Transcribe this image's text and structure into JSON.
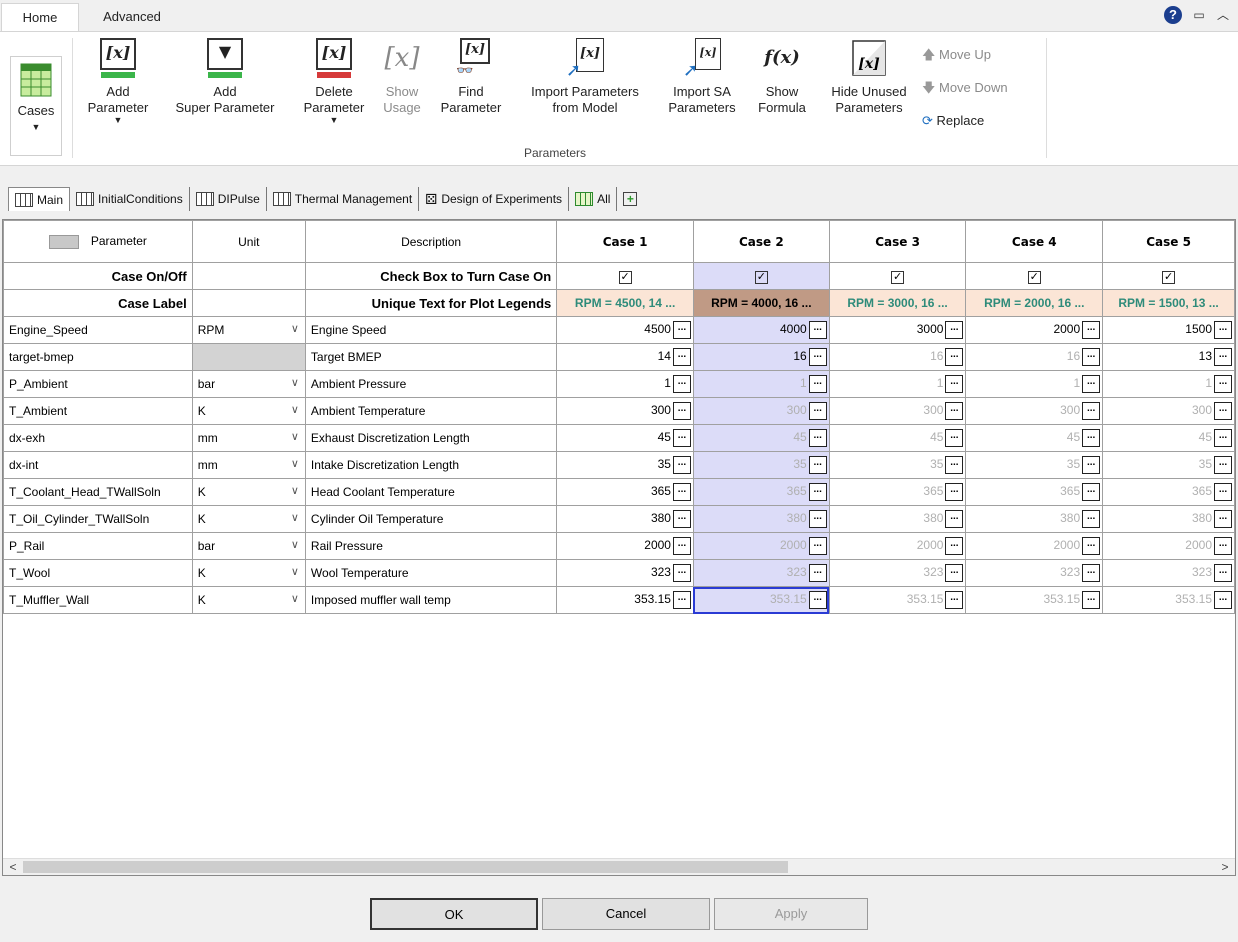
{
  "ribbon_tabs": [
    {
      "label": "Home"
    },
    {
      "label": "Advanced"
    }
  ],
  "ribbon": {
    "cases": "Cases",
    "add_parameter": [
      "Add",
      "Parameter"
    ],
    "add_super": [
      "Add",
      "Super Parameter"
    ],
    "delete_parameter": [
      "Delete",
      "Parameter"
    ],
    "show_usage": [
      "Show",
      "Usage"
    ],
    "find_parameter": [
      "Find",
      "Parameter"
    ],
    "import_params": [
      "Import Parameters",
      "from Model"
    ],
    "import_sa": [
      "Import SA",
      "Parameters"
    ],
    "show_formula": [
      "Show",
      "Formula"
    ],
    "hide_unused": [
      "Hide Unused",
      "Parameters"
    ],
    "move_up": "Move Up",
    "move_down": "Move Down",
    "replace": "Replace",
    "group_label": "Parameters",
    "x_glyph": "[x]",
    "fx_glyph": "f(x)"
  },
  "sheet_tabs": [
    {
      "label": "Main"
    },
    {
      "label": "InitialConditions"
    },
    {
      "label": "DIPulse"
    },
    {
      "label": "Thermal Management"
    },
    {
      "label": "Design of Experiments"
    },
    {
      "label": "All"
    }
  ],
  "table": {
    "headers": {
      "parameter": "Parameter",
      "unit": "Unit",
      "description": "Description"
    },
    "cases": [
      "Case 1",
      "Case 2",
      "Case 3",
      "Case 4",
      "Case 5"
    ],
    "case_onoff": {
      "label": "Case On/Off",
      "description": "Check Box to Turn Case On",
      "checked": [
        true,
        true,
        true,
        true,
        true
      ]
    },
    "case_label": {
      "label": "Case Label",
      "description": "Unique Text for Plot Legends",
      "values": [
        "RPM = 4500, 14 ...",
        "RPM = 4000, 16 ...",
        "RPM = 3000, 16 ...",
        "RPM = 2000, 16 ...",
        "RPM = 1500, 13 ..."
      ]
    },
    "rows": [
      {
        "name": "Engine_Speed",
        "unit": "RPM",
        "desc": "Engine Speed",
        "values": [
          "4500",
          "4000",
          "3000",
          "2000",
          "1500"
        ],
        "dim": [
          false,
          false,
          false,
          false,
          false
        ]
      },
      {
        "name": "target-bmep",
        "unit": "",
        "desc": "Target BMEP",
        "values": [
          "14",
          "16",
          "16",
          "16",
          "13"
        ],
        "dim": [
          false,
          false,
          true,
          true,
          false
        ]
      },
      {
        "name": "P_Ambient",
        "unit": "bar",
        "desc": "Ambient Pressure",
        "values": [
          "1",
          "1",
          "1",
          "1",
          "1"
        ],
        "dim": [
          false,
          true,
          true,
          true,
          true
        ]
      },
      {
        "name": "T_Ambient",
        "unit": "K",
        "desc": "Ambient Temperature",
        "values": [
          "300",
          "300",
          "300",
          "300",
          "300"
        ],
        "dim": [
          false,
          true,
          true,
          true,
          true
        ]
      },
      {
        "name": "dx-exh",
        "unit": "mm",
        "desc": "Exhaust Discretization Length",
        "values": [
          "45",
          "45",
          "45",
          "45",
          "45"
        ],
        "dim": [
          false,
          true,
          true,
          true,
          true
        ]
      },
      {
        "name": "dx-int",
        "unit": "mm",
        "desc": "Intake Discretization Length",
        "values": [
          "35",
          "35",
          "35",
          "35",
          "35"
        ],
        "dim": [
          false,
          true,
          true,
          true,
          true
        ]
      },
      {
        "name": "T_Coolant_Head_TWallSoln",
        "unit": "K",
        "desc": "Head Coolant Temperature",
        "values": [
          "365",
          "365",
          "365",
          "365",
          "365"
        ],
        "dim": [
          false,
          true,
          true,
          true,
          true
        ]
      },
      {
        "name": "T_Oil_Cylinder_TWallSoln",
        "unit": "K",
        "desc": "Cylinder Oil Temperature",
        "values": [
          "380",
          "380",
          "380",
          "380",
          "380"
        ],
        "dim": [
          false,
          true,
          true,
          true,
          true
        ]
      },
      {
        "name": "P_Rail",
        "unit": "bar",
        "desc": "Rail Pressure",
        "values": [
          "2000",
          "2000",
          "2000",
          "2000",
          "2000"
        ],
        "dim": [
          false,
          true,
          true,
          true,
          true
        ]
      },
      {
        "name": "T_Wool",
        "unit": "K",
        "desc": "Wool Temperature",
        "values": [
          "323",
          "323",
          "323",
          "323",
          "323"
        ],
        "dim": [
          false,
          true,
          true,
          true,
          true
        ]
      },
      {
        "name": "T_Muffler_Wall",
        "unit": "K",
        "desc": "Imposed muffler wall temp",
        "values": [
          "353.15",
          "353.15",
          "353.15",
          "353.15",
          "353.15"
        ],
        "dim": [
          false,
          true,
          true,
          true,
          true
        ]
      }
    ]
  },
  "buttons": {
    "ok": "OK",
    "cancel": "Cancel",
    "apply": "Apply"
  },
  "colors": {
    "label_bg": "#fbe5d6",
    "label_text": "#2e8b7a",
    "selected_label_bg": "#c09a85",
    "selected_col": "#dcdcf8"
  }
}
